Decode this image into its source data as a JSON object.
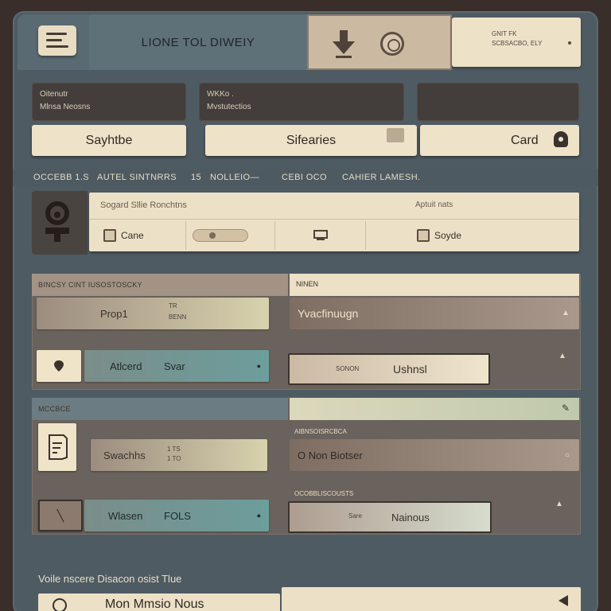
{
  "header": {
    "title": "LIONE TOL DIWEIY",
    "info_line1": "GNIT FK",
    "info_line2": "SCBSACBO, ELY"
  },
  "cards": [
    {
      "line1": "Oitenutr",
      "line2": "Mlnsa Neosns"
    },
    {
      "line1": "WKKo .",
      "line2": "Mvstutectios"
    },
    {
      "line1": "",
      "line2": ""
    }
  ],
  "buttons": {
    "b1": "Sayhtbe",
    "b2": "Sifearies",
    "b3": "Card"
  },
  "strip": {
    "s1": "OCCEBB 1.S",
    "s2": "AUTEL SINTNRRS",
    "s3": "15",
    "s4": "NOLLEIO—",
    "s5": "CEBI OCO",
    "s6": "CAHIER LAMESH."
  },
  "table": {
    "head_left": "Sogard Sllie Ronchtns",
    "head_right": "Aptuit nats",
    "c1": "Cane",
    "c4": "Soyde"
  },
  "panel1": {
    "title": "BINCSY CINT IUSOSTOSCKY",
    "right_head": "NINEN",
    "f1": "Prop1",
    "f1_small_1": "TR",
    "f1_small_2": "BENN",
    "f2": "Yvacfinuugn",
    "f3": "Atlcerd",
    "f3b": "Svar",
    "f4_small": "SONON",
    "f4": "Ushnsl"
  },
  "panel2": {
    "title": "MCCBCE",
    "sub_head1": "AIBNSOISRCBCA",
    "sub_head2": "OCOBBLISCOUSTS",
    "f1": "Swachhs",
    "f1_small_1": "1 TS",
    "f1_small_2": "1 TO",
    "f2": "O Non Biotser",
    "f3": "Wlasen",
    "f3b": "FOLS",
    "f4_small": "Sare",
    "f4": "Nainous"
  },
  "bottom": {
    "label": "Voile nscere Disacon osist Tlue",
    "button": "Mon Mmsio Nous"
  }
}
